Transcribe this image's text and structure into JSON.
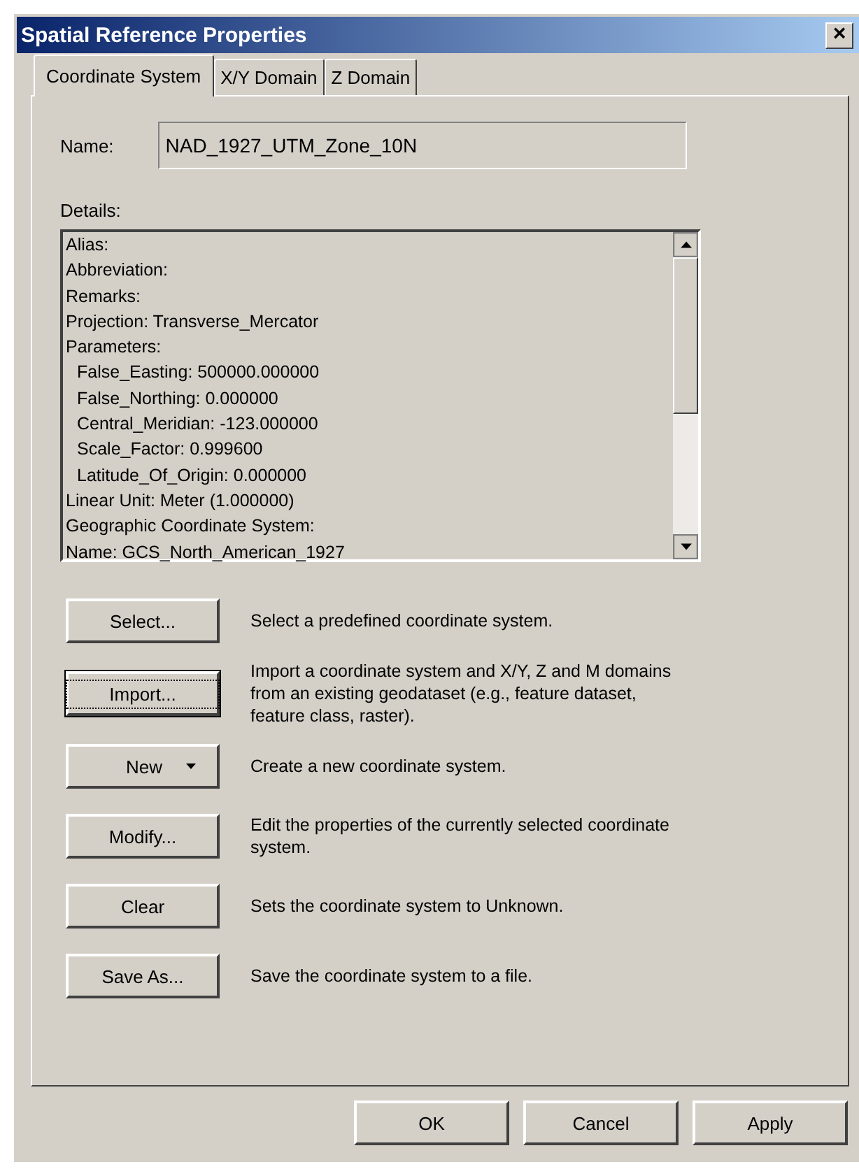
{
  "window": {
    "title": "Spatial Reference Properties",
    "close": "×"
  },
  "tabs": [
    {
      "label": "Coordinate System",
      "selected": true
    },
    {
      "label": "X/Y Domain",
      "selected": false
    },
    {
      "label": "Z Domain",
      "selected": false
    }
  ],
  "name": {
    "label": "Name:",
    "value": "NAD_1927_UTM_Zone_10N"
  },
  "details": {
    "label": "Details:",
    "lines": [
      {
        "text": "Alias:",
        "indented": false
      },
      {
        "text": "Abbreviation:",
        "indented": false
      },
      {
        "text": "Remarks:",
        "indented": false
      },
      {
        "text": "Projection: Transverse_Mercator",
        "indented": false
      },
      {
        "text": "Parameters:",
        "indented": false
      },
      {
        "text": "False_Easting: 500000.000000",
        "indented": true
      },
      {
        "text": "False_Northing: 0.000000",
        "indented": true
      },
      {
        "text": "Central_Meridian: -123.000000",
        "indented": true
      },
      {
        "text": "Scale_Factor: 0.999600",
        "indented": true
      },
      {
        "text": "Latitude_Of_Origin: 0.000000",
        "indented": true
      },
      {
        "text": "Linear Unit: Meter (1.000000)",
        "indented": false
      },
      {
        "text": "Geographic Coordinate System:",
        "indented": false
      },
      {
        "text": "Name: GCS_North_American_1927",
        "indented": false
      }
    ]
  },
  "actions": [
    {
      "label": "Select...",
      "kind": "plain",
      "focused": false,
      "description": "Select a predefined coordinate system."
    },
    {
      "label": "Import...",
      "kind": "plain",
      "focused": true,
      "description": "Import a coordinate system and X/Y, Z and M domains from an existing geodataset (e.g., feature dataset, feature class, raster)."
    },
    {
      "label": "New",
      "kind": "dropdown",
      "focused": false,
      "description": "Create a new coordinate system."
    },
    {
      "label": "Modify...",
      "kind": "plain",
      "focused": false,
      "description": "Edit the properties of the currently selected coordinate system."
    },
    {
      "label": "Clear",
      "kind": "plain",
      "focused": false,
      "description": "Sets the coordinate system to Unknown."
    },
    {
      "label": "Save As...",
      "kind": "plain",
      "focused": false,
      "description": "Save the coordinate system to a file."
    }
  ],
  "buttons": [
    {
      "label": "OK"
    },
    {
      "label": "Cancel"
    },
    {
      "label": "Apply"
    }
  ]
}
